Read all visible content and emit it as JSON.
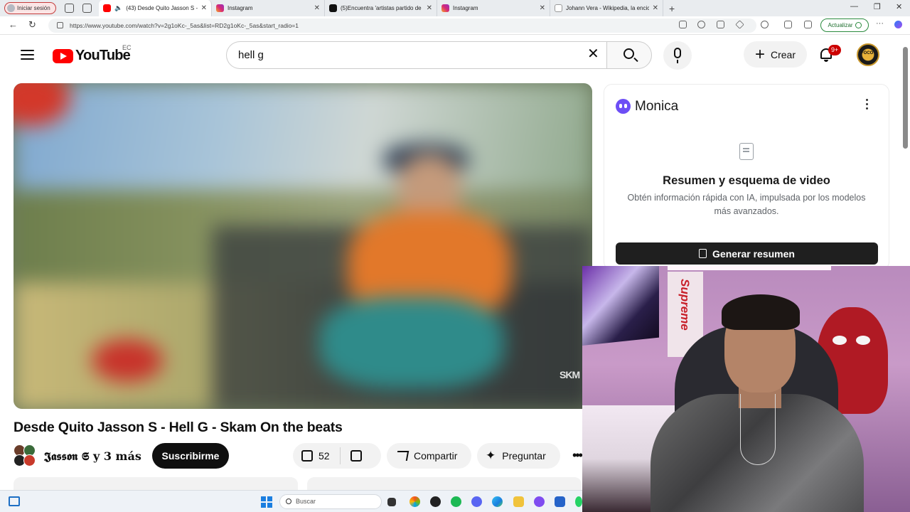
{
  "browser": {
    "profile_label": "Iniciar sesión",
    "tabs": [
      {
        "title": "(43) Desde Quito Jasson S -",
        "favicon": "youtube-icon",
        "active": true
      },
      {
        "title": "Instagram",
        "favicon": "instagram-icon",
        "active": false
      },
      {
        "title": "(5)Encuentra 'artistas partido de",
        "favicon": "tiktok-icon",
        "active": false
      },
      {
        "title": "Instagram",
        "favicon": "instagram-icon",
        "active": false
      },
      {
        "title": "Johann Vera - Wikipedia, la encic",
        "favicon": "wikipedia-icon",
        "active": false
      }
    ],
    "url": "https://www.youtube.com/watch?v=2g1oKc-_5as&list=RD2g1oKc-_5as&start_radio=1",
    "update_label": "Actualizar",
    "new_tab": "+",
    "close_glyph": "✕",
    "window_controls": {
      "minimize": "—",
      "restore": "❐",
      "close": "✕"
    },
    "nav": {
      "back": "←",
      "reload": "↻"
    }
  },
  "youtube": {
    "logo_text": "YouTube",
    "country_code": "EC",
    "search_value": "hell g",
    "clear_glyph": "✕",
    "create_label": "Crear",
    "create_plus": "+",
    "notification_badge": "9+",
    "avatar_text": "FOCO",
    "video": {
      "watermark": "SKM",
      "title": "Desde Quito Jasson S - Hell G - Skam On the beats",
      "channel": "𝕵𝖆𝖘𝖘𝖔𝖓 𝕾 y 3 más",
      "subscribe_label": "Suscribirme",
      "likes": "52",
      "share_label": "Compartir",
      "ask_label": "Preguntar",
      "sparkle": "✦",
      "more_glyph": "•••"
    }
  },
  "monica": {
    "title": "Monica",
    "heading": "Resumen y esquema de video",
    "description": "Obtén información rápida con IA, impulsada por los modelos más avanzados.",
    "button_label": "Generar resumen"
  },
  "webcam": {
    "poster_text": "Supreme"
  },
  "taskbar": {
    "search_placeholder": "Buscar"
  },
  "colors": {
    "youtube_red": "#ff0000",
    "badge_red": "#cc0000",
    "subscribe_bg": "#0f0f0f",
    "update_green": "#2a8a3e",
    "monica_purple": "#6d4ef5"
  }
}
